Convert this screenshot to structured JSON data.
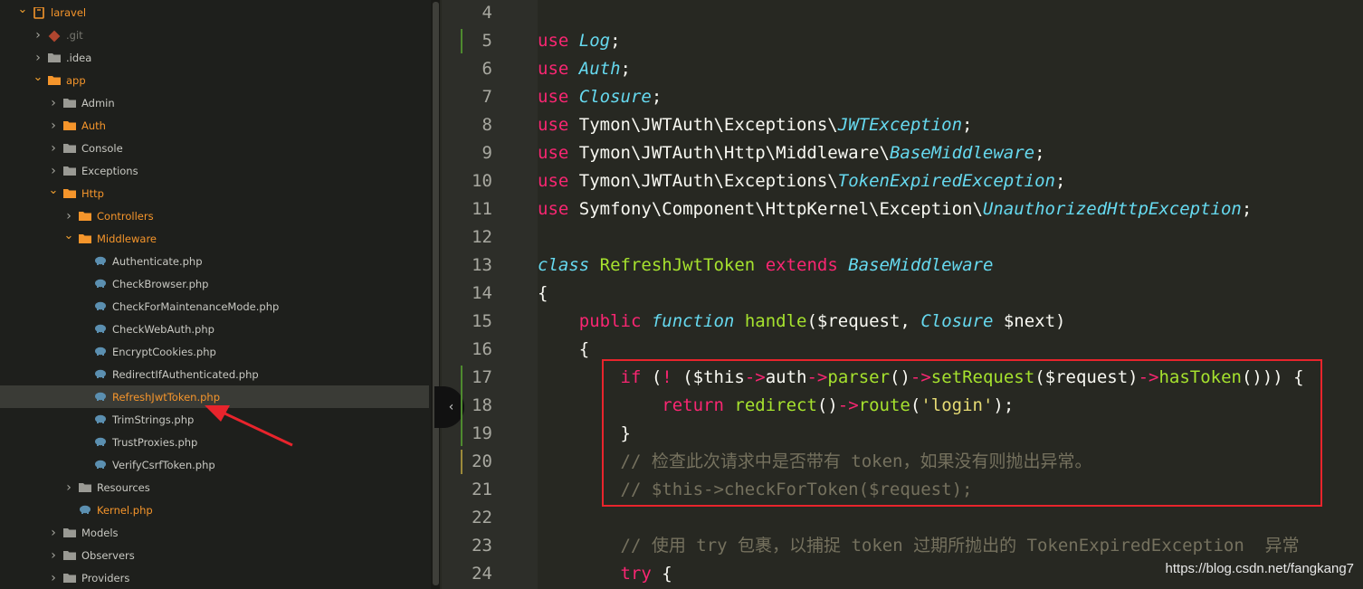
{
  "sidebar": {
    "items": [
      {
        "label": "laravel",
        "depth": 0,
        "type": "project",
        "open": true,
        "color": "orange"
      },
      {
        "label": ".git",
        "depth": 1,
        "type": "git",
        "open": false,
        "color": "dim"
      },
      {
        "label": ".idea",
        "depth": 1,
        "type": "folder",
        "open": false,
        "color": "normal"
      },
      {
        "label": "app",
        "depth": 1,
        "type": "folder",
        "open": true,
        "color": "orange"
      },
      {
        "label": "Admin",
        "depth": 2,
        "type": "folder",
        "open": false,
        "color": "normal"
      },
      {
        "label": "Auth",
        "depth": 2,
        "type": "folder",
        "open": false,
        "color": "orange"
      },
      {
        "label": "Console",
        "depth": 2,
        "type": "folder",
        "open": false,
        "color": "normal"
      },
      {
        "label": "Exceptions",
        "depth": 2,
        "type": "folder",
        "open": false,
        "color": "normal"
      },
      {
        "label": "Http",
        "depth": 2,
        "type": "folder",
        "open": true,
        "color": "orange"
      },
      {
        "label": "Controllers",
        "depth": 3,
        "type": "folder",
        "open": false,
        "color": "orange"
      },
      {
        "label": "Middleware",
        "depth": 3,
        "type": "folder",
        "open": true,
        "color": "orange"
      },
      {
        "label": "Authenticate.php",
        "depth": 4,
        "type": "php",
        "color": "normal"
      },
      {
        "label": "CheckBrowser.php",
        "depth": 4,
        "type": "php",
        "color": "normal"
      },
      {
        "label": "CheckForMaintenanceMode.php",
        "depth": 4,
        "type": "php",
        "color": "normal"
      },
      {
        "label": "CheckWebAuth.php",
        "depth": 4,
        "type": "php",
        "color": "normal"
      },
      {
        "label": "EncryptCookies.php",
        "depth": 4,
        "type": "php",
        "color": "normal"
      },
      {
        "label": "RedirectIfAuthenticated.php",
        "depth": 4,
        "type": "php",
        "color": "normal"
      },
      {
        "label": "RefreshJwtToken.php",
        "depth": 4,
        "type": "php",
        "color": "orange",
        "selected": true
      },
      {
        "label": "TrimStrings.php",
        "depth": 4,
        "type": "php",
        "color": "normal"
      },
      {
        "label": "TrustProxies.php",
        "depth": 4,
        "type": "php",
        "color": "normal"
      },
      {
        "label": "VerifyCsrfToken.php",
        "depth": 4,
        "type": "php",
        "color": "normal"
      },
      {
        "label": "Resources",
        "depth": 3,
        "type": "folder",
        "open": false,
        "color": "normal"
      },
      {
        "label": "Kernel.php",
        "depth": 3,
        "type": "php",
        "color": "orange"
      },
      {
        "label": "Models",
        "depth": 2,
        "type": "folder",
        "open": false,
        "color": "normal"
      },
      {
        "label": "Observers",
        "depth": 2,
        "type": "folder",
        "open": false,
        "color": "normal"
      },
      {
        "label": "Providers",
        "depth": 2,
        "type": "folder",
        "open": false,
        "color": "normal"
      }
    ]
  },
  "editor": {
    "collapse_icon": "‹",
    "lines": [
      {
        "n": "4",
        "tokens": []
      },
      {
        "n": "5",
        "tokens": [
          [
            "kw",
            "use"
          ],
          [
            "",
            " "
          ],
          [
            "st",
            "Log"
          ],
          [
            "",
            ";"
          ]
        ]
      },
      {
        "n": "6",
        "tokens": [
          [
            "kw",
            "use"
          ],
          [
            "",
            " "
          ],
          [
            "st",
            "Auth"
          ],
          [
            "",
            ";"
          ]
        ]
      },
      {
        "n": "7",
        "tokens": [
          [
            "kw",
            "use"
          ],
          [
            "",
            " "
          ],
          [
            "st",
            "Closure"
          ],
          [
            "",
            ";"
          ]
        ]
      },
      {
        "n": "8",
        "tokens": [
          [
            "kw",
            "use"
          ],
          [
            "",
            " Tymon\\JWTAuth\\Exceptions\\"
          ],
          [
            "st",
            "JWTException"
          ],
          [
            "",
            ";"
          ]
        ]
      },
      {
        "n": "9",
        "tokens": [
          [
            "kw",
            "use"
          ],
          [
            "",
            " Tymon\\JWTAuth\\Http\\Middleware\\"
          ],
          [
            "st",
            "BaseMiddleware"
          ],
          [
            "",
            ";"
          ]
        ]
      },
      {
        "n": "10",
        "tokens": [
          [
            "kw",
            "use"
          ],
          [
            "",
            " Tymon\\JWTAuth\\Exceptions\\"
          ],
          [
            "st",
            "TokenExpiredException"
          ],
          [
            "",
            ";"
          ]
        ]
      },
      {
        "n": "11",
        "tokens": [
          [
            "kw",
            "use"
          ],
          [
            "",
            " Symfony\\Component\\HttpKernel\\Exception\\"
          ],
          [
            "st",
            "UnauthorizedHttpException"
          ],
          [
            "",
            ";"
          ]
        ]
      },
      {
        "n": "12",
        "tokens": []
      },
      {
        "n": "13",
        "tokens": [
          [
            "st",
            "class"
          ],
          [
            "",
            " "
          ],
          [
            "cls",
            "RefreshJwtToken"
          ],
          [
            "",
            " "
          ],
          [
            "kw",
            "extends"
          ],
          [
            "",
            " "
          ],
          [
            "st",
            "BaseMiddleware"
          ]
        ]
      },
      {
        "n": "14",
        "tokens": [
          [
            "",
            "{"
          ]
        ]
      },
      {
        "n": "15",
        "tokens": [
          [
            "",
            "    "
          ],
          [
            "kw",
            "public"
          ],
          [
            "",
            " "
          ],
          [
            "st",
            "function"
          ],
          [
            "",
            " "
          ],
          [
            "fn",
            "handle"
          ],
          [
            "",
            "($request, "
          ],
          [
            "st",
            "Closure"
          ],
          [
            "",
            " $next)"
          ]
        ]
      },
      {
        "n": "16",
        "tokens": [
          [
            "",
            "    {"
          ]
        ]
      },
      {
        "n": "17",
        "tokens": [
          [
            "",
            "        "
          ],
          [
            "kw",
            "if"
          ],
          [
            "",
            " ("
          ],
          [
            "kw",
            "!"
          ],
          [
            "",
            " ($this"
          ],
          [
            "kw",
            "->"
          ],
          [
            "",
            "auth"
          ],
          [
            "kw",
            "->"
          ],
          [
            "fn",
            "parser"
          ],
          [
            "",
            "()"
          ],
          [
            "kw",
            "->"
          ],
          [
            "fn",
            "setRequest"
          ],
          [
            "",
            "($request)"
          ],
          [
            "kw",
            "->"
          ],
          [
            "fn",
            "hasToken"
          ],
          [
            "",
            "())) {"
          ]
        ]
      },
      {
        "n": "18",
        "tokens": [
          [
            "",
            "            "
          ],
          [
            "kw",
            "return"
          ],
          [
            "",
            " "
          ],
          [
            "fn",
            "redirect"
          ],
          [
            "",
            "()"
          ],
          [
            "kw",
            "->"
          ],
          [
            "fn",
            "route"
          ],
          [
            "",
            "("
          ],
          [
            "str",
            "'login'"
          ],
          [
            "",
            ");"
          ]
        ]
      },
      {
        "n": "19",
        "tokens": [
          [
            "",
            "        }"
          ]
        ]
      },
      {
        "n": "20",
        "tokens": [
          [
            "",
            "        "
          ],
          [
            "cm",
            "// 检查此次请求中是否带有 token，如果没有则抛出异常。"
          ]
        ]
      },
      {
        "n": "21",
        "tokens": [
          [
            "",
            "        "
          ],
          [
            "cm",
            "// $this->checkForToken($request);"
          ]
        ]
      },
      {
        "n": "22",
        "tokens": []
      },
      {
        "n": "23",
        "tokens": [
          [
            "",
            "        "
          ],
          [
            "cm",
            "// 使用 try 包裹，以捕捉 token 过期所抛出的 TokenExpiredException  异常"
          ]
        ]
      },
      {
        "n": "24",
        "tokens": [
          [
            "",
            "        "
          ],
          [
            "kw",
            "try"
          ],
          [
            "",
            " {"
          ]
        ]
      }
    ]
  },
  "watermark": "https://blog.csdn.net/fangkang7",
  "colors": {
    "accent": "#f5952b",
    "highlight_box": "#e8242c",
    "arrow": "#e8242c"
  }
}
